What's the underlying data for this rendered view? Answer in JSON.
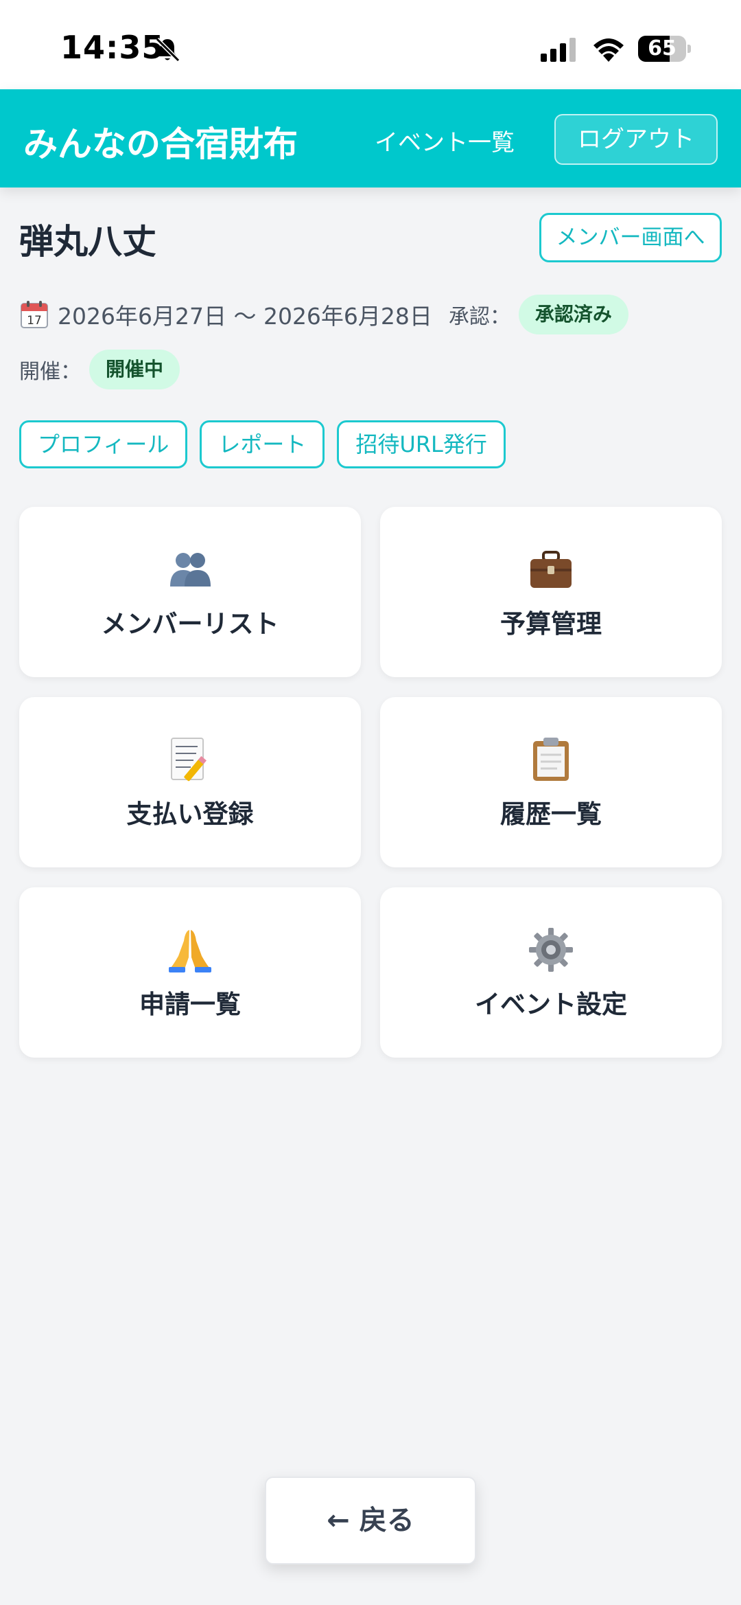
{
  "status_bar": {
    "time": "14:35",
    "battery": "65",
    "battery_level": 0.65
  },
  "header": {
    "title": "みんなの合宿財布",
    "nav_events": "イベント一覧",
    "logout": "ログアウト"
  },
  "event": {
    "name": "弾丸八丈",
    "member_screen_button": "メンバー画面へ",
    "dates": "2026年6月27日 〜 2026年6月28日",
    "approval_label": "承認：",
    "approval_status": "承認済み",
    "held_label": "開催：",
    "held_status": "開催中"
  },
  "chips": [
    "プロフィール",
    "レポート",
    "招待URL発行"
  ],
  "cards": [
    {
      "label": "メンバーリスト",
      "icon": "members-icon"
    },
    {
      "label": "予算管理",
      "icon": "briefcase-icon"
    },
    {
      "label": "支払い登録",
      "icon": "memo-icon"
    },
    {
      "label": "履歴一覧",
      "icon": "clipboard-icon"
    },
    {
      "label": "申請一覧",
      "icon": "pray-icon"
    },
    {
      "label": "イベント設定",
      "icon": "gear-icon"
    }
  ],
  "back_button": "← 戻る",
  "colors": {
    "accent": "#00c8cc",
    "badge_bg": "#d1fae5",
    "badge_text": "#14532d"
  }
}
